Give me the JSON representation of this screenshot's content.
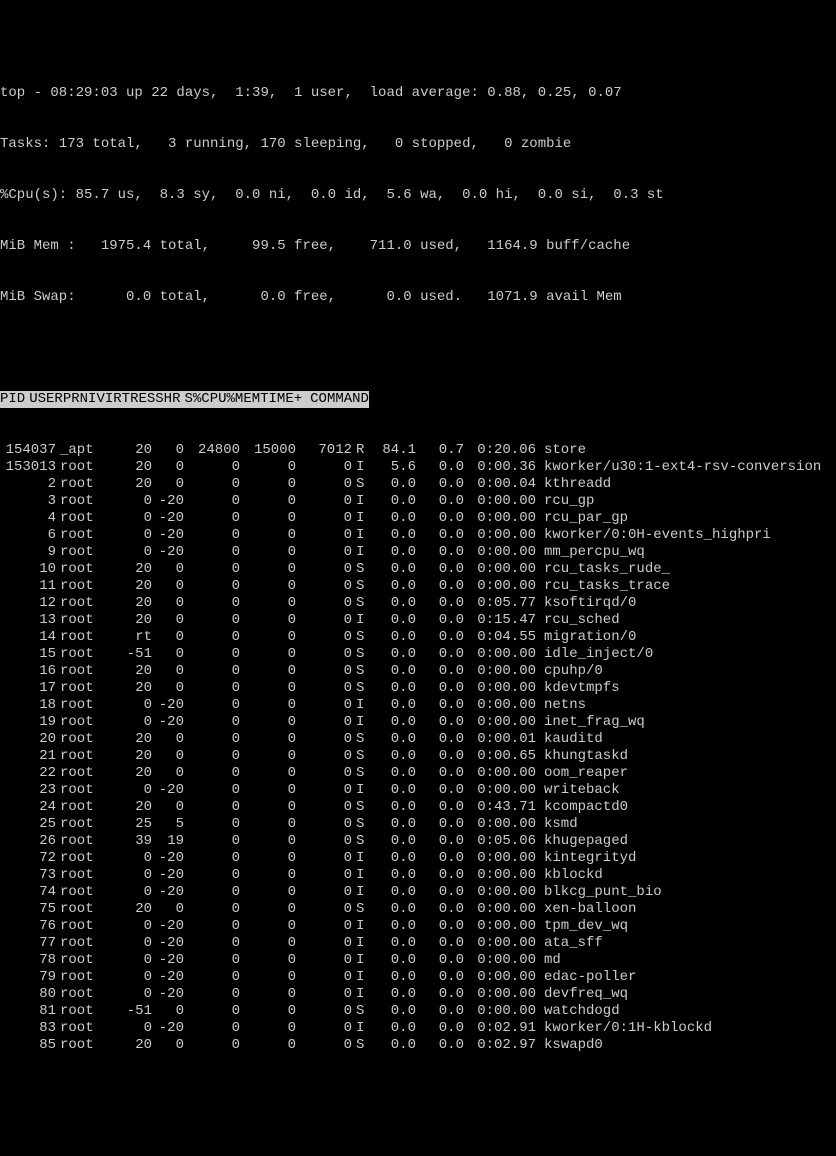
{
  "summary": {
    "line1": "top - 08:29:03 up 22 days,  1:39,  1 user,  load average: 0.88, 0.25, 0.07",
    "line2": "Tasks: 173 total,   3 running, 170 sleeping,   0 stopped,   0 zombie",
    "line3": "%Cpu(s): 85.7 us,  8.3 sy,  0.0 ni,  0.0 id,  5.6 wa,  0.0 hi,  0.0 si,  0.3 st",
    "line4": "MiB Mem :   1975.4 total,     99.5 free,    711.0 used,   1164.9 buff/cache",
    "line5": "MiB Swap:      0.0 total,      0.0 free,      0.0 used.   1071.9 avail Mem"
  },
  "columns": {
    "pid": "PID",
    "user": "USER",
    "pr": "PR",
    "ni": "NI",
    "virt": "VIRT",
    "res": "RES",
    "shr": "SHR",
    "s": "S",
    "cpu": "%CPU",
    "mem": "%MEM",
    "time": "TIME+",
    "cmd": "COMMAND"
  },
  "processes": [
    {
      "pid": "154037",
      "user": "_apt",
      "pr": "20",
      "ni": "0",
      "virt": "24800",
      "res": "15000",
      "shr": "7012",
      "s": "R",
      "cpu": "84.1",
      "mem": "0.7",
      "time": "0:20.06",
      "cmd": "store"
    },
    {
      "pid": "153013",
      "user": "root",
      "pr": "20",
      "ni": "0",
      "virt": "0",
      "res": "0",
      "shr": "0",
      "s": "I",
      "cpu": "5.6",
      "mem": "0.0",
      "time": "0:00.36",
      "cmd": "kworker/u30:1-ext4-rsv-conversion"
    },
    {
      "pid": "2",
      "user": "root",
      "pr": "20",
      "ni": "0",
      "virt": "0",
      "res": "0",
      "shr": "0",
      "s": "S",
      "cpu": "0.0",
      "mem": "0.0",
      "time": "0:00.04",
      "cmd": "kthreadd"
    },
    {
      "pid": "3",
      "user": "root",
      "pr": "0",
      "ni": "-20",
      "virt": "0",
      "res": "0",
      "shr": "0",
      "s": "I",
      "cpu": "0.0",
      "mem": "0.0",
      "time": "0:00.00",
      "cmd": "rcu_gp"
    },
    {
      "pid": "4",
      "user": "root",
      "pr": "0",
      "ni": "-20",
      "virt": "0",
      "res": "0",
      "shr": "0",
      "s": "I",
      "cpu": "0.0",
      "mem": "0.0",
      "time": "0:00.00",
      "cmd": "rcu_par_gp"
    },
    {
      "pid": "6",
      "user": "root",
      "pr": "0",
      "ni": "-20",
      "virt": "0",
      "res": "0",
      "shr": "0",
      "s": "I",
      "cpu": "0.0",
      "mem": "0.0",
      "time": "0:00.00",
      "cmd": "kworker/0:0H-events_highpri"
    },
    {
      "pid": "9",
      "user": "root",
      "pr": "0",
      "ni": "-20",
      "virt": "0",
      "res": "0",
      "shr": "0",
      "s": "I",
      "cpu": "0.0",
      "mem": "0.0",
      "time": "0:00.00",
      "cmd": "mm_percpu_wq"
    },
    {
      "pid": "10",
      "user": "root",
      "pr": "20",
      "ni": "0",
      "virt": "0",
      "res": "0",
      "shr": "0",
      "s": "S",
      "cpu": "0.0",
      "mem": "0.0",
      "time": "0:00.00",
      "cmd": "rcu_tasks_rude_"
    },
    {
      "pid": "11",
      "user": "root",
      "pr": "20",
      "ni": "0",
      "virt": "0",
      "res": "0",
      "shr": "0",
      "s": "S",
      "cpu": "0.0",
      "mem": "0.0",
      "time": "0:00.00",
      "cmd": "rcu_tasks_trace"
    },
    {
      "pid": "12",
      "user": "root",
      "pr": "20",
      "ni": "0",
      "virt": "0",
      "res": "0",
      "shr": "0",
      "s": "S",
      "cpu": "0.0",
      "mem": "0.0",
      "time": "0:05.77",
      "cmd": "ksoftirqd/0"
    },
    {
      "pid": "13",
      "user": "root",
      "pr": "20",
      "ni": "0",
      "virt": "0",
      "res": "0",
      "shr": "0",
      "s": "I",
      "cpu": "0.0",
      "mem": "0.0",
      "time": "0:15.47",
      "cmd": "rcu_sched"
    },
    {
      "pid": "14",
      "user": "root",
      "pr": "rt",
      "ni": "0",
      "virt": "0",
      "res": "0",
      "shr": "0",
      "s": "S",
      "cpu": "0.0",
      "mem": "0.0",
      "time": "0:04.55",
      "cmd": "migration/0"
    },
    {
      "pid": "15",
      "user": "root",
      "pr": "-51",
      "ni": "0",
      "virt": "0",
      "res": "0",
      "shr": "0",
      "s": "S",
      "cpu": "0.0",
      "mem": "0.0",
      "time": "0:00.00",
      "cmd": "idle_inject/0"
    },
    {
      "pid": "16",
      "user": "root",
      "pr": "20",
      "ni": "0",
      "virt": "0",
      "res": "0",
      "shr": "0",
      "s": "S",
      "cpu": "0.0",
      "mem": "0.0",
      "time": "0:00.00",
      "cmd": "cpuhp/0"
    },
    {
      "pid": "17",
      "user": "root",
      "pr": "20",
      "ni": "0",
      "virt": "0",
      "res": "0",
      "shr": "0",
      "s": "S",
      "cpu": "0.0",
      "mem": "0.0",
      "time": "0:00.00",
      "cmd": "kdevtmpfs"
    },
    {
      "pid": "18",
      "user": "root",
      "pr": "0",
      "ni": "-20",
      "virt": "0",
      "res": "0",
      "shr": "0",
      "s": "I",
      "cpu": "0.0",
      "mem": "0.0",
      "time": "0:00.00",
      "cmd": "netns"
    },
    {
      "pid": "19",
      "user": "root",
      "pr": "0",
      "ni": "-20",
      "virt": "0",
      "res": "0",
      "shr": "0",
      "s": "I",
      "cpu": "0.0",
      "mem": "0.0",
      "time": "0:00.00",
      "cmd": "inet_frag_wq"
    },
    {
      "pid": "20",
      "user": "root",
      "pr": "20",
      "ni": "0",
      "virt": "0",
      "res": "0",
      "shr": "0",
      "s": "S",
      "cpu": "0.0",
      "mem": "0.0",
      "time": "0:00.01",
      "cmd": "kauditd"
    },
    {
      "pid": "21",
      "user": "root",
      "pr": "20",
      "ni": "0",
      "virt": "0",
      "res": "0",
      "shr": "0",
      "s": "S",
      "cpu": "0.0",
      "mem": "0.0",
      "time": "0:00.65",
      "cmd": "khungtaskd"
    },
    {
      "pid": "22",
      "user": "root",
      "pr": "20",
      "ni": "0",
      "virt": "0",
      "res": "0",
      "shr": "0",
      "s": "S",
      "cpu": "0.0",
      "mem": "0.0",
      "time": "0:00.00",
      "cmd": "oom_reaper"
    },
    {
      "pid": "23",
      "user": "root",
      "pr": "0",
      "ni": "-20",
      "virt": "0",
      "res": "0",
      "shr": "0",
      "s": "I",
      "cpu": "0.0",
      "mem": "0.0",
      "time": "0:00.00",
      "cmd": "writeback"
    },
    {
      "pid": "24",
      "user": "root",
      "pr": "20",
      "ni": "0",
      "virt": "0",
      "res": "0",
      "shr": "0",
      "s": "S",
      "cpu": "0.0",
      "mem": "0.0",
      "time": "0:43.71",
      "cmd": "kcompactd0"
    },
    {
      "pid": "25",
      "user": "root",
      "pr": "25",
      "ni": "5",
      "virt": "0",
      "res": "0",
      "shr": "0",
      "s": "S",
      "cpu": "0.0",
      "mem": "0.0",
      "time": "0:00.00",
      "cmd": "ksmd"
    },
    {
      "pid": "26",
      "user": "root",
      "pr": "39",
      "ni": "19",
      "virt": "0",
      "res": "0",
      "shr": "0",
      "s": "S",
      "cpu": "0.0",
      "mem": "0.0",
      "time": "0:05.06",
      "cmd": "khugepaged"
    },
    {
      "pid": "72",
      "user": "root",
      "pr": "0",
      "ni": "-20",
      "virt": "0",
      "res": "0",
      "shr": "0",
      "s": "I",
      "cpu": "0.0",
      "mem": "0.0",
      "time": "0:00.00",
      "cmd": "kintegrityd"
    },
    {
      "pid": "73",
      "user": "root",
      "pr": "0",
      "ni": "-20",
      "virt": "0",
      "res": "0",
      "shr": "0",
      "s": "I",
      "cpu": "0.0",
      "mem": "0.0",
      "time": "0:00.00",
      "cmd": "kblockd"
    },
    {
      "pid": "74",
      "user": "root",
      "pr": "0",
      "ni": "-20",
      "virt": "0",
      "res": "0",
      "shr": "0",
      "s": "I",
      "cpu": "0.0",
      "mem": "0.0",
      "time": "0:00.00",
      "cmd": "blkcg_punt_bio"
    },
    {
      "pid": "75",
      "user": "root",
      "pr": "20",
      "ni": "0",
      "virt": "0",
      "res": "0",
      "shr": "0",
      "s": "S",
      "cpu": "0.0",
      "mem": "0.0",
      "time": "0:00.00",
      "cmd": "xen-balloon"
    },
    {
      "pid": "76",
      "user": "root",
      "pr": "0",
      "ni": "-20",
      "virt": "0",
      "res": "0",
      "shr": "0",
      "s": "I",
      "cpu": "0.0",
      "mem": "0.0",
      "time": "0:00.00",
      "cmd": "tpm_dev_wq"
    },
    {
      "pid": "77",
      "user": "root",
      "pr": "0",
      "ni": "-20",
      "virt": "0",
      "res": "0",
      "shr": "0",
      "s": "I",
      "cpu": "0.0",
      "mem": "0.0",
      "time": "0:00.00",
      "cmd": "ata_sff"
    },
    {
      "pid": "78",
      "user": "root",
      "pr": "0",
      "ni": "-20",
      "virt": "0",
      "res": "0",
      "shr": "0",
      "s": "I",
      "cpu": "0.0",
      "mem": "0.0",
      "time": "0:00.00",
      "cmd": "md"
    },
    {
      "pid": "79",
      "user": "root",
      "pr": "0",
      "ni": "-20",
      "virt": "0",
      "res": "0",
      "shr": "0",
      "s": "I",
      "cpu": "0.0",
      "mem": "0.0",
      "time": "0:00.00",
      "cmd": "edac-poller"
    },
    {
      "pid": "80",
      "user": "root",
      "pr": "0",
      "ni": "-20",
      "virt": "0",
      "res": "0",
      "shr": "0",
      "s": "I",
      "cpu": "0.0",
      "mem": "0.0",
      "time": "0:00.00",
      "cmd": "devfreq_wq"
    },
    {
      "pid": "81",
      "user": "root",
      "pr": "-51",
      "ni": "0",
      "virt": "0",
      "res": "0",
      "shr": "0",
      "s": "S",
      "cpu": "0.0",
      "mem": "0.0",
      "time": "0:00.00",
      "cmd": "watchdogd"
    },
    {
      "pid": "83",
      "user": "root",
      "pr": "0",
      "ni": "-20",
      "virt": "0",
      "res": "0",
      "shr": "0",
      "s": "I",
      "cpu": "0.0",
      "mem": "0.0",
      "time": "0:02.91",
      "cmd": "kworker/0:1H-kblockd"
    },
    {
      "pid": "85",
      "user": "root",
      "pr": "20",
      "ni": "0",
      "virt": "0",
      "res": "0",
      "shr": "0",
      "s": "S",
      "cpu": "0.0",
      "mem": "0.0",
      "time": "0:02.97",
      "cmd": "kswapd0"
    }
  ]
}
